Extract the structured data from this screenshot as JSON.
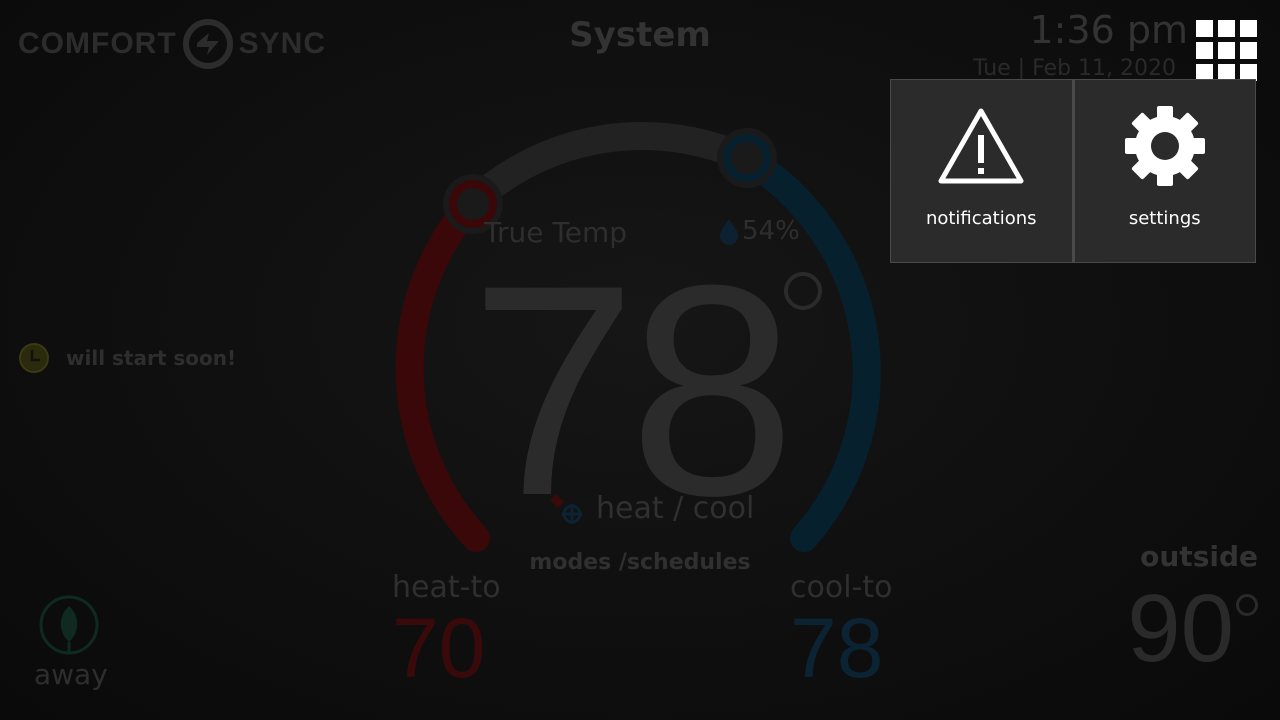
{
  "header": {
    "logo_left": "COMFORT",
    "logo_right": "SYNC",
    "title": "System",
    "time": "1:36 pm",
    "date": "Tue | Feb 11, 2020"
  },
  "dial": {
    "true_temp_label": "True Temp",
    "humidity": "54%",
    "current_temp": "78",
    "mode": "heat / cool",
    "modes_schedules": "modes /schedules",
    "heat_to_label": "heat-to",
    "heat_to_value": "70",
    "cool_to_label": "cool-to",
    "cool_to_value": "78"
  },
  "status": {
    "message": "will start soon!"
  },
  "away": {
    "label": "away"
  },
  "outside": {
    "label": "outside",
    "value": "90"
  },
  "menu": {
    "items": [
      {
        "label": "notifications",
        "icon": "warning-icon"
      },
      {
        "label": "settings",
        "icon": "gear-icon"
      }
    ]
  },
  "colors": {
    "heat": "#3a0a0a",
    "cool": "#0b2333",
    "menu_bg": "#2b2b2b",
    "menu_border": "#4a4a4a"
  }
}
